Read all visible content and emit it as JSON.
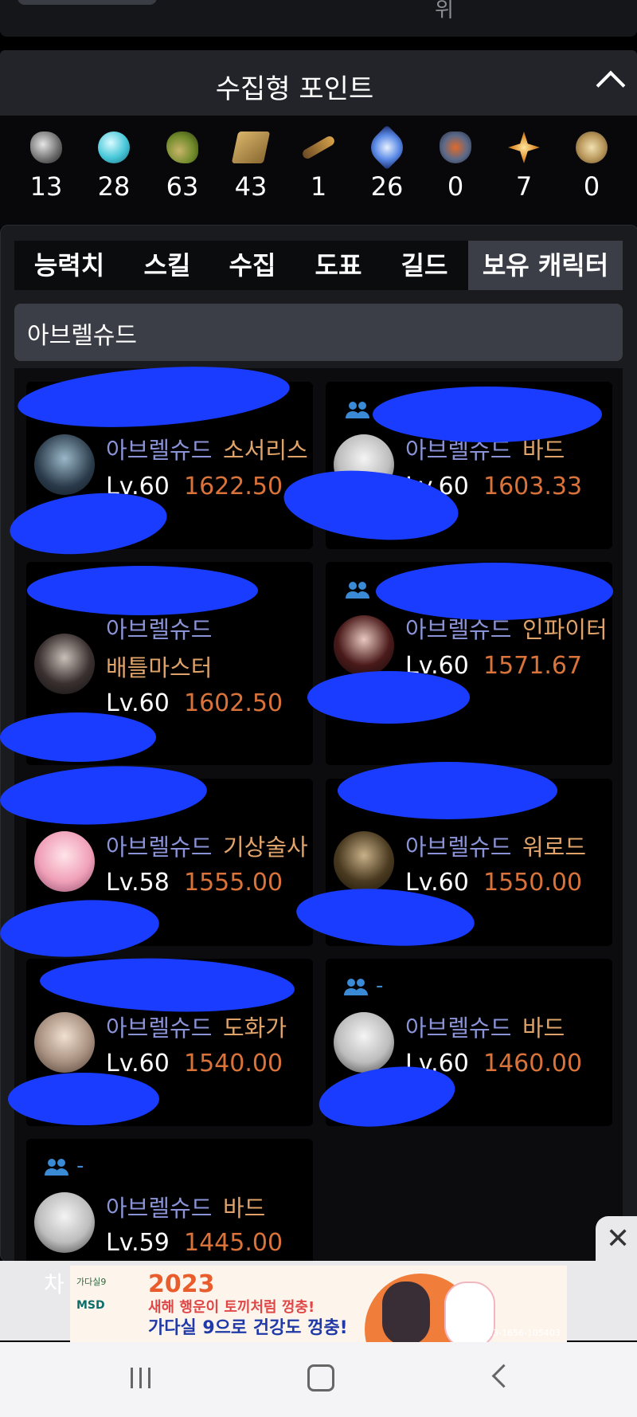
{
  "header": {
    "partial_label": "위"
  },
  "section": {
    "title": "수집형 포인트"
  },
  "points": [
    {
      "icon": "heart-seed-icon",
      "value": "13"
    },
    {
      "icon": "globe-island-icon",
      "value": "28"
    },
    {
      "icon": "sprout-icon",
      "value": "63"
    },
    {
      "icon": "map-scroll-icon",
      "value": "43"
    },
    {
      "icon": "telescope-icon",
      "value": "1"
    },
    {
      "icon": "leaf-star-icon",
      "value": "26"
    },
    {
      "icon": "crest-icon",
      "value": "0"
    },
    {
      "icon": "compass-star-icon",
      "value": "7"
    },
    {
      "icon": "medal-icon",
      "value": "0"
    }
  ],
  "tabs": [
    {
      "label": "능력치"
    },
    {
      "label": "스킬"
    },
    {
      "label": "수집"
    },
    {
      "label": "도표"
    },
    {
      "label": "길드"
    },
    {
      "label": "보유 캐릭터",
      "active": true
    }
  ],
  "search": {
    "value": "아브렐슈드"
  },
  "characters": [
    {
      "server": "아브렐슈드",
      "class": "소서리스",
      "level": "Lv.60",
      "item_level": "1622.50"
    },
    {
      "server": "아브렐슈드",
      "class": "바드",
      "level": "Lv.60",
      "item_level": "1603.33"
    },
    {
      "server": "아브렐슈드",
      "class": "배틀마스터",
      "level": "Lv.60",
      "item_level": "1602.50"
    },
    {
      "server": "아브렐슈드",
      "class": "인파이터",
      "level": "Lv.60",
      "item_level": "1571.67"
    },
    {
      "server": "아브렐슈드",
      "class": "기상술사",
      "level": "Lv.58",
      "item_level": "1555.00"
    },
    {
      "server": "아브렐슈드",
      "class": "워로드",
      "level": "Lv.60",
      "item_level": "1550.00"
    },
    {
      "server": "아브렐슈드",
      "class": "도화가",
      "level": "Lv.60",
      "item_level": "1540.00"
    },
    {
      "server": "아브렐슈드",
      "class": "바드",
      "level": "Lv.60",
      "item_level": "1460.00",
      "guild": "-"
    },
    {
      "server": "아브렐슈드",
      "class": "바드",
      "level": "Lv.59",
      "item_level": "1445.00",
      "guild": "-"
    }
  ],
  "partial_text": "차",
  "ad": {
    "year": "2023",
    "line1": "새해 행운이 토끼처럼 껑충!",
    "line2": "가다실 9으로 건강도 껑충!",
    "code": "2023-1656-105403",
    "brand": "MSD",
    "product": "가다실9"
  },
  "colors": {
    "server": "#8a93d8",
    "class": "#e0a36a",
    "item_level": "#d9733a",
    "party_icon": "#3a8ad6",
    "redaction": "#1a3cff"
  }
}
